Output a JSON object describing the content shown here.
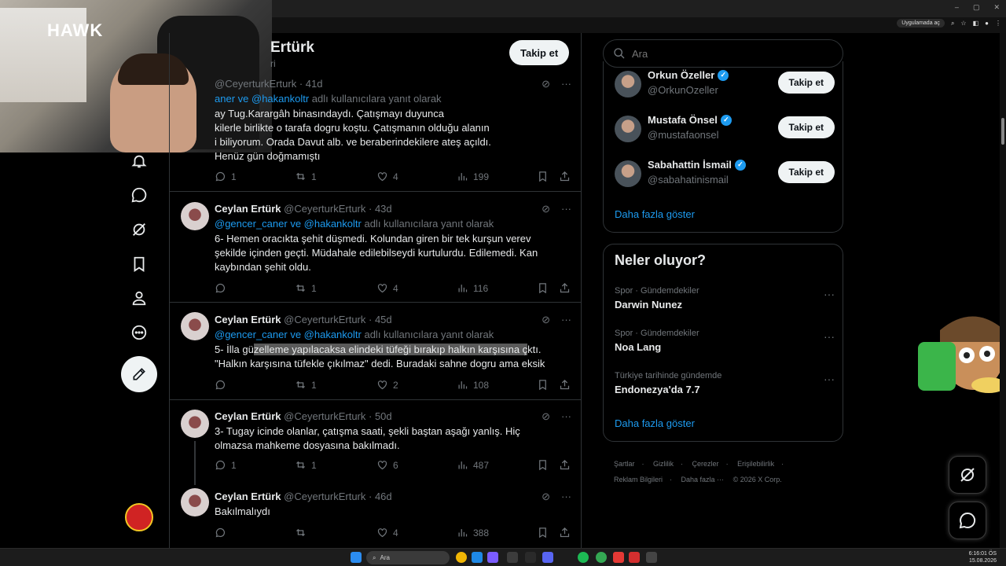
{
  "browser": {
    "extension_pill": "Uygulamada aç",
    "window_controls": [
      "–",
      "▢",
      "✕"
    ]
  },
  "webcam": {
    "logo": "HAWK"
  },
  "profile": {
    "name": "Ceylan Ertürk",
    "name_visible": "Ertürk",
    "sub": "ri",
    "follow_label": "Takip et"
  },
  "tweets": [
    {
      "name": "",
      "handle": "@CeyerturkErturk",
      "age": "41d",
      "reply_prefix": "",
      "mention1": "aner",
      "mention_join": " ve ",
      "mention2": "@hakankoltr",
      "reply_suffix": " adlı kullanıcılara yanıt olarak",
      "body_lines": [
        "ay Tug.Karargâh binasındaydı. Çatışmayı duyunca",
        "kilerle birlikte o tarafa dogru koştu. Çatışmanın olduğu alanın",
        "i biliyorum. Orada Davut alb. ve beraberindekilere ateş açıldı.",
        "Henüz gün doğmamıştı"
      ],
      "replies": "1",
      "reposts": "1",
      "likes": "4",
      "views": "199"
    },
    {
      "name": "Ceylan Ertürk",
      "handle": "@CeyerturkErturk",
      "age": "43d",
      "mention1": "@gencer_caner",
      "mention_join": " ve ",
      "mention2": "@hakankoltr",
      "reply_suffix": " adlı kullanıcılara yanıt olarak",
      "body_lines": [
        "6- Hemen oracıkta şehit düşmedi.  Kolundan giren bir tek kurşun verev",
        "şekilde içinden geçti. Müdahale edilebilseydi kurtulurdu. Edilemedi. Kan",
        "kaybından şehit oldu."
      ],
      "replies": "",
      "reposts": "1",
      "likes": "4",
      "views": "116"
    },
    {
      "name": "Ceylan Ertürk",
      "handle": "@CeyerturkErturk",
      "age": "45d",
      "mention1": "@gencer_caner",
      "mention_join": " ve ",
      "mention2": "@hakankoltr",
      "reply_suffix": " adlı kullanıcılara yanıt olarak",
      "body_pre": "5- İlla gü",
      "body_sel": "zelleme yapılacaksa elindeki tüfeği bırakıp halkın karşısına ç",
      "body_post": "ktı.",
      "body_line2": "\"Halkın karşısına tüfekle çıkılmaz\" dedi. Buradaki sahne dogru ama eksik",
      "replies": "",
      "reposts": "1",
      "likes": "2",
      "views": "108"
    },
    {
      "name": "Ceylan Ertürk",
      "handle": "@CeyerturkErturk",
      "age": "50d",
      "body_lines": [
        "3- Tugay icinde olanlar, çatışma saati, şekli baştan aşağı yanlış.  Hiç",
        "olmazsa mahkeme dosyasına bakılmadı."
      ],
      "replies": "1",
      "reposts": "1",
      "likes": "6",
      "views": "487"
    },
    {
      "name": "Ceylan Ertürk",
      "handle": "@CeyerturkErturk",
      "age": "46d",
      "body_lines": [
        "Bakılmalıydı"
      ],
      "replies": "",
      "reposts": "",
      "likes": "4",
      "views": "388"
    }
  ],
  "meta_sep": " · ",
  "search": {
    "placeholder": "Ara"
  },
  "who_to_follow": {
    "items": [
      {
        "name": "Orkun Özeller",
        "handle": "@OrkunOzeller",
        "button": "Takip et"
      },
      {
        "name": "Mustafa Önsel",
        "handle": "@mustafaonsel",
        "button": "Takip et"
      },
      {
        "name": "Sabahattin İsmail",
        "handle": "@sabahatinismail",
        "button": "Takip et"
      }
    ],
    "show_more": "Daha fazla göster"
  },
  "trends": {
    "title": "Neler oluyor?",
    "items": [
      {
        "category": "Spor · Gündemdekiler",
        "name": "Darwin Nunez"
      },
      {
        "category": "Spor · Gündemdekiler",
        "name": "Noa Lang"
      },
      {
        "category": "Türkiye tarihinde gündemde",
        "name": "Endonezya'da 7.7"
      }
    ],
    "show_more": "Daha fazla göster"
  },
  "footer": {
    "links": [
      "Şartlar",
      "·",
      "Gizlilik",
      "·",
      "Çerezler",
      "·",
      "Erişilebilirlik",
      "·",
      "Reklam Bilgileri",
      "·",
      "Daha fazla ···",
      "© 2026 X Corp."
    ]
  },
  "taskbar": {
    "search_label": "Ara",
    "time": "6:16:01 ÖS",
    "date": "15.08.2026"
  },
  "colors": {
    "accent": "#1d9bf0",
    "background": "#000000",
    "text": "#e7e9ea",
    "muted": "#71767b",
    "border": "#2f3336"
  }
}
